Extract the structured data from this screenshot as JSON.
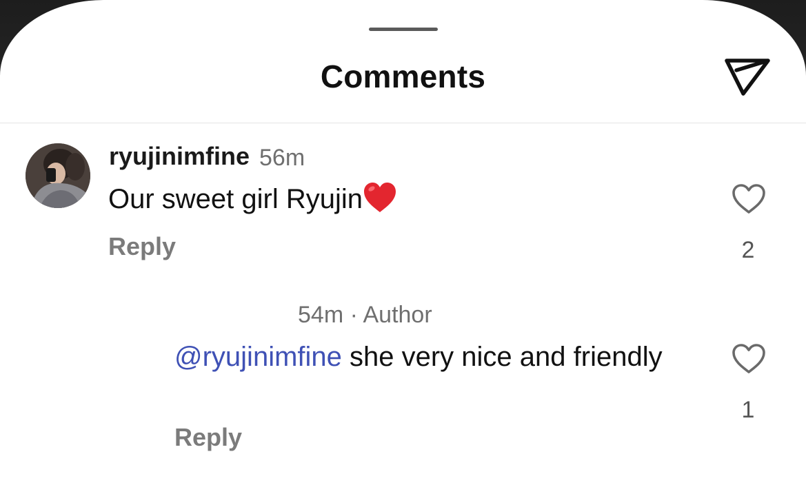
{
  "header": {
    "title": "Comments"
  },
  "comment": {
    "username": "ryujinimfine",
    "time": "56m",
    "text": "Our sweet girl Ryujin",
    "emoji": "red-heart",
    "reply_label": "Reply",
    "like_count": "2"
  },
  "reply": {
    "meta": "54m · Author",
    "mention": "@ryujinimfine",
    "text": " she very nice and friendly",
    "reply_label": "Reply",
    "like_count": "1"
  },
  "colors": {
    "mention": "#3f51b5",
    "emoji_heart": "#e3262f"
  }
}
